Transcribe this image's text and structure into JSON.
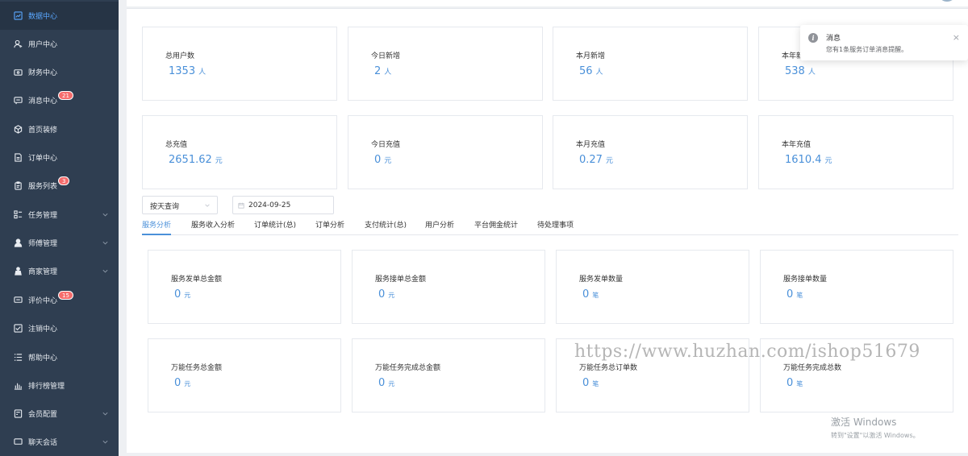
{
  "sidebar": {
    "items": [
      {
        "label": "数据中心",
        "icon": "dashboard-icon",
        "active": true
      },
      {
        "label": "用户中心",
        "icon": "user-icon"
      },
      {
        "label": "财务中心",
        "icon": "wallet-icon"
      },
      {
        "label": "消息中心",
        "icon": "message-icon",
        "badge": "21"
      },
      {
        "label": "首页装修",
        "icon": "cube-icon"
      },
      {
        "label": "订单中心",
        "icon": "document-icon"
      },
      {
        "label": "服务列表",
        "icon": "clipboard-icon",
        "badge": "3"
      },
      {
        "label": "任务管理",
        "icon": "grid-list-icon",
        "expandable": true
      },
      {
        "label": "师傅管理",
        "icon": "person-icon",
        "expandable": true
      },
      {
        "label": "商家管理",
        "icon": "merchant-icon",
        "expandable": true
      },
      {
        "label": "评价中心",
        "icon": "comment-icon",
        "badge": "15"
      },
      {
        "label": "注销中心",
        "icon": "logout-icon"
      },
      {
        "label": "帮助中心",
        "icon": "list-icon"
      },
      {
        "label": "排行榜管理",
        "icon": "bar-chart-icon"
      },
      {
        "label": "会员配置",
        "icon": "member-card-icon",
        "expandable": true
      },
      {
        "label": "聊天会话",
        "icon": "chat-icon",
        "expandable": true
      }
    ]
  },
  "stats_row1": [
    {
      "label": "总用户数",
      "value": "1353",
      "unit": "人"
    },
    {
      "label": "今日新增",
      "value": "2",
      "unit": "人"
    },
    {
      "label": "本月新增",
      "value": "56",
      "unit": "人"
    },
    {
      "label": "本年新",
      "value": "538",
      "unit": "人"
    }
  ],
  "stats_row2": [
    {
      "label": "总充值",
      "value": "2651.62",
      "unit": "元"
    },
    {
      "label": "今日充值",
      "value": "0",
      "unit": "元"
    },
    {
      "label": "本月充值",
      "value": "0.27",
      "unit": "元"
    },
    {
      "label": "本年充值",
      "value": "1610.4",
      "unit": "元"
    }
  ],
  "filters": {
    "query_mode": "按天查询",
    "date": "2024-09-25"
  },
  "tabs": [
    {
      "label": "服务分析",
      "active": true
    },
    {
      "label": "服务收入分析"
    },
    {
      "label": "订单统计(总)"
    },
    {
      "label": "订单分析"
    },
    {
      "label": "支付统计(总)"
    },
    {
      "label": "用户分析"
    },
    {
      "label": "平台佣金统计"
    },
    {
      "label": "待处理事项"
    }
  ],
  "service_stats_row1": [
    {
      "label": "服务发单总金额",
      "value": "0",
      "unit": "元"
    },
    {
      "label": "服务接单总金额",
      "value": "0",
      "unit": "元"
    },
    {
      "label": "服务发单数量",
      "value": "0",
      "unit": "笔"
    },
    {
      "label": "服务接单数量",
      "value": "0",
      "unit": "笔"
    }
  ],
  "service_stats_row2": [
    {
      "label": "万能任务总金额",
      "value": "0",
      "unit": "元"
    },
    {
      "label": "万能任务完成总金额",
      "value": "0",
      "unit": "元"
    },
    {
      "label": "万能任务总订单数",
      "value": "0",
      "unit": "笔"
    },
    {
      "label": "万能任务完成总数",
      "value": "0",
      "unit": "笔"
    }
  ],
  "notification": {
    "title": "消息",
    "message": "您有1条服务订单消息提醒。",
    "close": "×",
    "icon": "info-icon"
  },
  "watermark": "https://www.huzhan.com/ishop51679",
  "windows_activation": {
    "line1": "激活 Windows",
    "line2": "转到\"设置\"以激活 Windows。"
  }
}
